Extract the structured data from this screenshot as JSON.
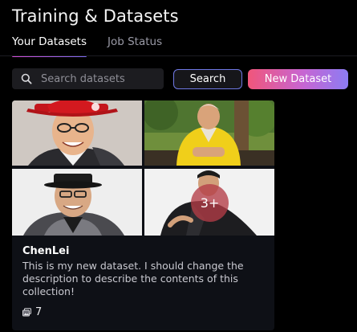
{
  "header": {
    "title": "Training & Datasets"
  },
  "tabs": [
    {
      "label": "Your Datasets",
      "active": true
    },
    {
      "label": "Job Status",
      "active": false
    }
  ],
  "search": {
    "placeholder": "Search datasets",
    "value": ""
  },
  "buttons": {
    "search_label": "Search",
    "new_dataset_label": "New Dataset"
  },
  "dataset_card": {
    "name": "ChenLei",
    "description": "This is my new dataset. I should change the description to describe the contents of this collection!",
    "more_images_label": "3+",
    "image_count": "7",
    "images_icon": "images-icon"
  },
  "colors": {
    "accent_gradient_start": "#f0567b",
    "accent_gradient_end": "#8c7cf3",
    "search_border": "#6f78e4"
  }
}
